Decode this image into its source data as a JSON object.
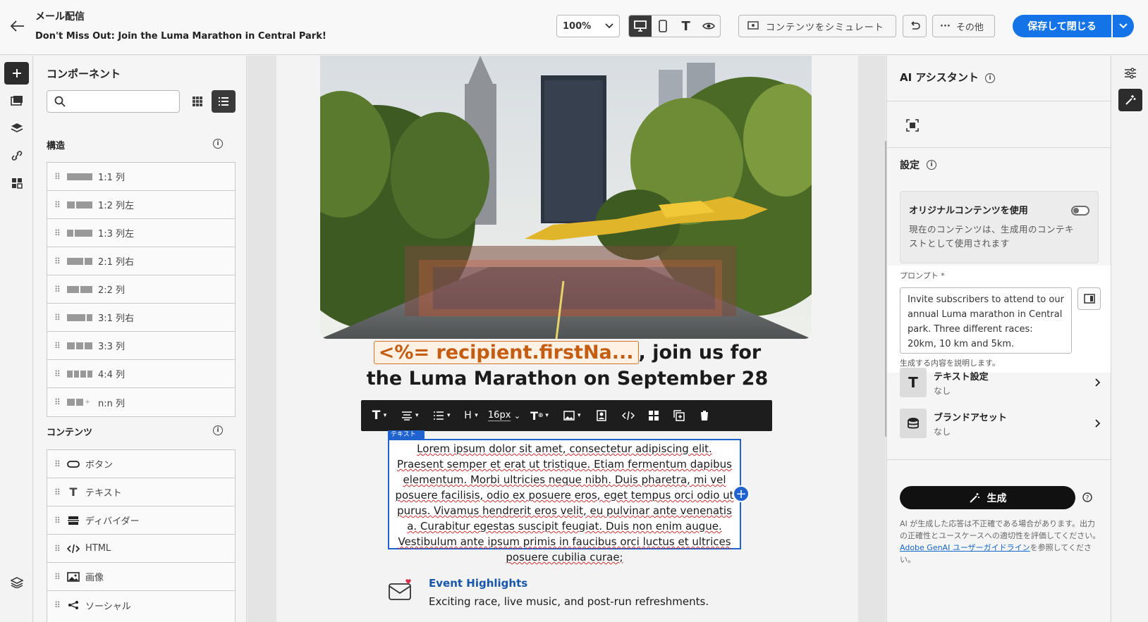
{
  "header": {
    "app_title": "メール配信",
    "email_subject": "Don't Miss Out: Join the Luma Marathon in Central Park!",
    "zoom": "100%",
    "simulate_label": "コンテンツをシミュレート",
    "more_label": "その他",
    "save_label": "保存して閉じる"
  },
  "left_panel": {
    "title": "コンポーネント",
    "search_placeholder": "",
    "structure_heading": "構造",
    "structure_items": [
      {
        "label": "1:1 列",
        "cols": [
          1
        ]
      },
      {
        "label": "1:2 列左",
        "cols": [
          1,
          2
        ]
      },
      {
        "label": "1:3 列左",
        "cols": [
          1,
          3
        ]
      },
      {
        "label": "2:1 列右",
        "cols": [
          2,
          1
        ]
      },
      {
        "label": "2:2 列",
        "cols": [
          1,
          1
        ]
      },
      {
        "label": "3:1 列右",
        "cols": [
          3,
          1
        ]
      },
      {
        "label": "3:3 列",
        "cols": [
          1,
          1,
          1
        ]
      },
      {
        "label": "4:4 列",
        "cols": [
          1,
          1,
          1,
          1
        ]
      },
      {
        "label": "n:n 列",
        "cols": [
          1,
          1,
          0
        ]
      }
    ],
    "content_heading": "コンテンツ",
    "content_items": [
      {
        "label": "ボタン",
        "icon": "button-icon"
      },
      {
        "label": "テキスト",
        "icon": "text-icon"
      },
      {
        "label": "ディバイダー",
        "icon": "divider-icon"
      },
      {
        "label": "HTML",
        "icon": "html-icon"
      },
      {
        "label": "画像",
        "icon": "image-icon"
      },
      {
        "label": "ソーシャル",
        "icon": "social-icon"
      }
    ]
  },
  "email": {
    "heading_token": "<%= recipient.firstNa...",
    "heading_rest": ", join us for",
    "heading_line2": "the Luma Marathon on September 28",
    "toolbar_font_size": "16px",
    "toolbar_heading": "H",
    "text_tag": "テキスト",
    "body_text": "Lorem ipsum dolor sit amet, consectetur adipiscing elit. Praesent semper et erat ut tristique. Etiam fermentum dapibus elementum. Morbi ultricies neque nibh. Duis pharetra, mi vel posuere facilisis, odio ex posuere eros, eget tempus orci odio ut purus. Vivamus hendrerit eros velit, eu pulvinar ante venenatis a. Curabitur egestas suscipit feugiat. Duis non enim augue. Vestibulum ante ipsum primis in faucibus orci luctus et ultrices posuere cubilia curae;",
    "event_title": "Event Highlights",
    "event_desc": "Exciting race, live music, and post-run refreshments."
  },
  "right_panel": {
    "title": "AI アシスタント",
    "settings_heading": "設定",
    "original_content_label": "オリジナルコンテンツを使用",
    "original_content_desc": "現在のコンテンツは、生成用のコンテキストとして使用されます",
    "original_content_enabled": false,
    "prompt_label": "プロンプト",
    "prompt_required": "*",
    "prompt_value": "Invite subscribers to attend to our annual Luma marathon in Central park. Three different races: 20km, 10 km and 5km.",
    "prompt_help": "生成する内容を説明します。",
    "text_settings_label": "テキスト設定",
    "text_settings_value": "なし",
    "brand_assets_label": "ブランドアセット",
    "brand_assets_value": "なし",
    "generate_label": "生成",
    "disclaimer_1": "AI が生成した応答は不正確である場合があります。出力の正確性とユースケースへの適切性を評価してください。",
    "disclaimer_link": "Adobe GenAI ユーザーガイドライン",
    "disclaimer_2": "を参照してください。"
  },
  "colors": {
    "accent": "#1473e6",
    "selection": "#1f63d0",
    "token_orange": "#c45c12",
    "event_blue": "#1655a8"
  }
}
